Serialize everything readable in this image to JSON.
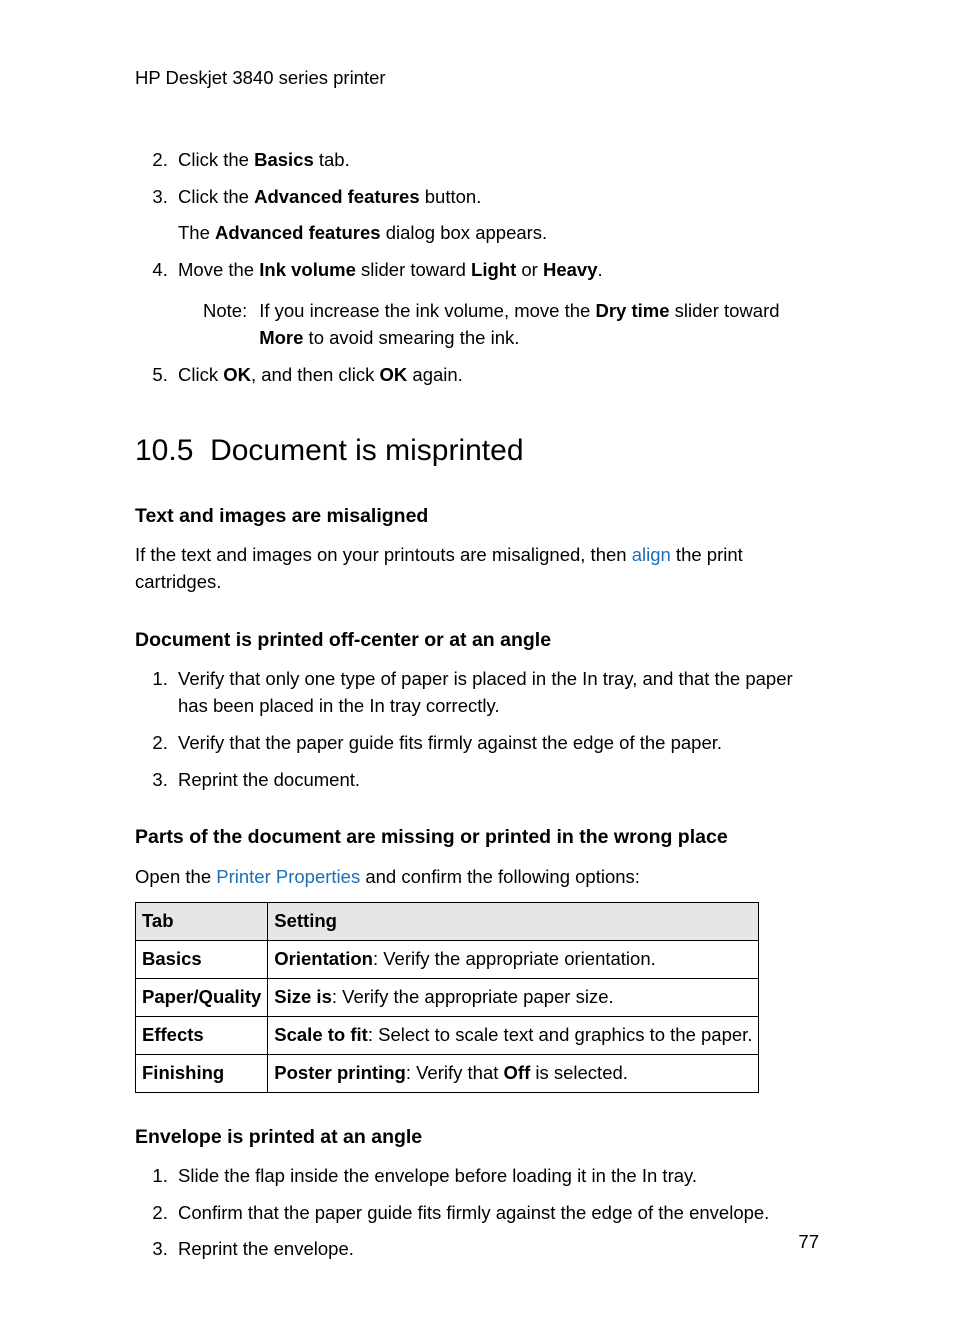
{
  "header": {
    "title": "HP Deskjet 3840 series printer"
  },
  "steps_top": {
    "start": 2,
    "items": [
      {
        "pre": "Click the ",
        "bold1": "Basics",
        "post1": " tab."
      },
      {
        "pre": "Click the ",
        "bold1": "Advanced features",
        "post1": " button.",
        "sub_pre": "The ",
        "sub_bold": "Advanced features",
        "sub_post": " dialog box appears."
      },
      {
        "pre": "Move the ",
        "bold1": "Ink volume",
        "mid1": " slider toward ",
        "bold2": "Light",
        "mid2": " or ",
        "bold3": "Heavy",
        "post1": ".",
        "note_label": "Note:",
        "note_pre": "If you increase the ink volume, move the ",
        "note_bold1": "Dry time",
        "note_mid": " slider toward ",
        "note_bold2": "More",
        "note_post": " to avoid smearing the ink."
      },
      {
        "pre": "Click ",
        "bold1": "OK",
        "mid1": ", and then click ",
        "bold2": "OK",
        "post1": " again."
      }
    ]
  },
  "section": {
    "number": "10.5",
    "title": "Document is misprinted"
  },
  "sub1": {
    "heading": "Text and images are misaligned",
    "p_pre": "If the text and images on your printouts are misaligned, then ",
    "link": "align",
    "p_post": " the print cartridges."
  },
  "sub2": {
    "heading": "Document is printed off-center or at an angle",
    "items": [
      "Verify that only one type of paper is placed in the In tray, and that the paper has been placed in the In tray correctly.",
      "Verify that the paper guide fits firmly against the edge of the paper.",
      "Reprint the document."
    ]
  },
  "sub3": {
    "heading": "Parts of the document are missing or printed in the wrong place",
    "p_pre": "Open the ",
    "link": "Printer Properties",
    "p_post": " and confirm the following options:",
    "table": {
      "h1": "Tab",
      "h2": "Setting",
      "rows": [
        {
          "tab": "Basics",
          "bold": "Orientation",
          "text": ": Verify the appropriate orientation."
        },
        {
          "tab": "Paper/Quality",
          "bold": "Size is",
          "text": ": Verify the appropriate paper size."
        },
        {
          "tab": "Effects",
          "bold": "Scale to fit",
          "text": ": Select to scale text and graphics to the paper."
        },
        {
          "tab": "Finishing",
          "bold": "Poster printing",
          "text_pre": ": Verify that ",
          "text_bold": "Off",
          "text_post": " is selected."
        }
      ]
    }
  },
  "sub4": {
    "heading": "Envelope is printed at an angle",
    "items": [
      "Slide the flap inside the envelope before loading it in the In tray.",
      "Confirm that the paper guide fits firmly against the edge of the envelope.",
      "Reprint the envelope."
    ]
  },
  "page_number": "77"
}
